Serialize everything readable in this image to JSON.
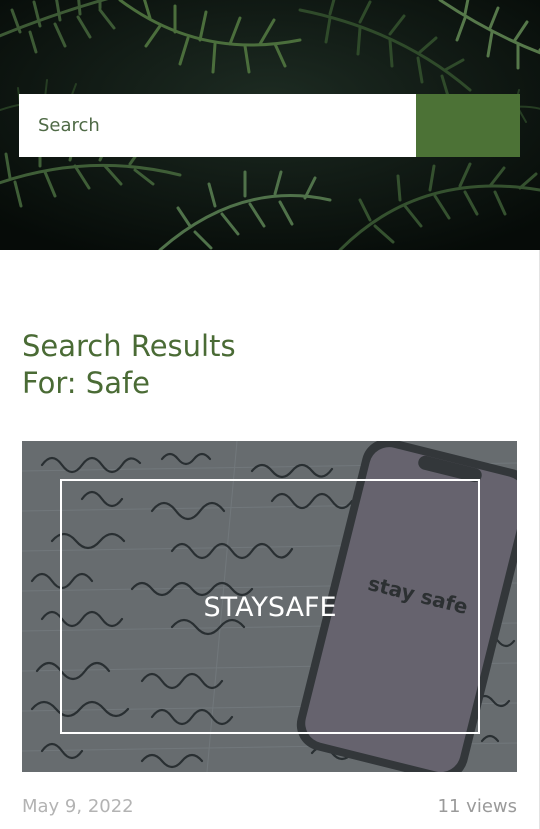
{
  "search": {
    "placeholder": "Search",
    "value": "",
    "button_icon": "search-icon"
  },
  "results": {
    "heading_line1": "Search Results",
    "heading_line2": "For: Safe"
  },
  "posts": [
    {
      "title": "STAYSAFE",
      "image_text": "stay safe",
      "date": "May 9, 2022",
      "views": "11 views"
    }
  ],
  "colors": {
    "accent_green": "#4c7236",
    "heading_green": "#4a6b35",
    "meta_gray": "#b3b3b3"
  }
}
